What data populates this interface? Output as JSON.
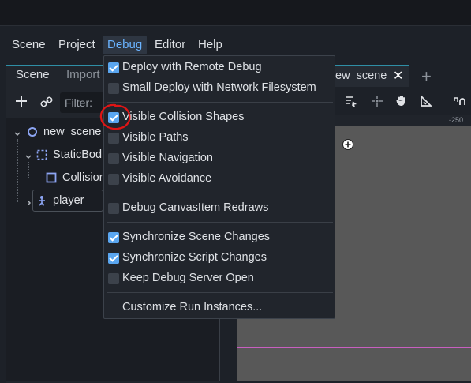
{
  "menubar": {
    "items": [
      {
        "label": "Scene"
      },
      {
        "label": "Project"
      },
      {
        "label": "Debug"
      },
      {
        "label": "Editor"
      },
      {
        "label": "Help"
      }
    ]
  },
  "dock": {
    "tabs": [
      {
        "label": "Scene"
      },
      {
        "label": "Import"
      }
    ],
    "filter_placeholder": "Filter: "
  },
  "tree": {
    "nodes": [
      {
        "label": "new_scene"
      },
      {
        "label": "StaticBod"
      },
      {
        "label": "Collision"
      },
      {
        "label": "player"
      }
    ]
  },
  "scene_tab": {
    "label": "ew_scene",
    "close": "✕",
    "add": "+"
  },
  "ruler": {
    "top_label": "-250"
  },
  "debug_menu": {
    "items": [
      {
        "label": "Deploy with Remote Debug",
        "checked": true
      },
      {
        "label": "Small Deploy with Network Filesystem",
        "checked": false
      },
      {
        "label": "Visible Collision Shapes",
        "checked": true
      },
      {
        "label": "Visible Paths",
        "checked": false
      },
      {
        "label": "Visible Navigation",
        "checked": false
      },
      {
        "label": "Visible Avoidance",
        "checked": false
      },
      {
        "label": "Debug CanvasItem Redraws",
        "checked": false
      },
      {
        "label": "Synchronize Scene Changes",
        "checked": true
      },
      {
        "label": "Synchronize Script Changes",
        "checked": true
      },
      {
        "label": "Keep Debug Server Open",
        "checked": false
      },
      {
        "label": "Customize Run Instances..."
      }
    ]
  },
  "colors": {
    "accent": "#6ab3ff",
    "checkbox_on": "#5aa6f0",
    "annotation": "#e01515"
  }
}
